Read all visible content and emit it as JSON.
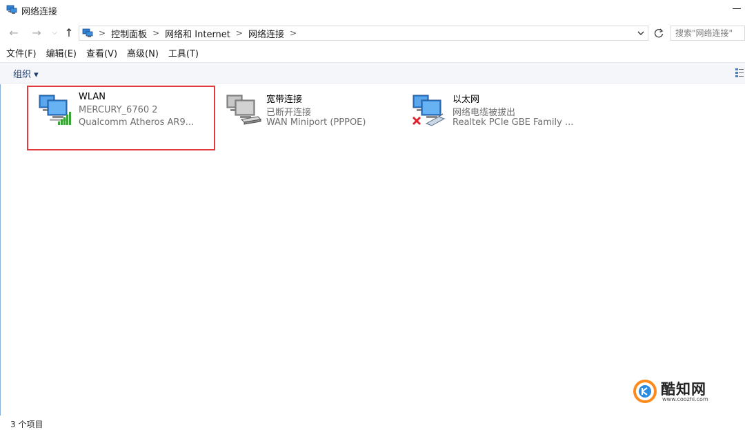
{
  "window": {
    "title": "网络连接"
  },
  "address": {
    "crumbs": [
      "控制面板",
      "网络和 Internet",
      "网络连接"
    ],
    "search_placeholder": "搜索\"网络连接\""
  },
  "menu": [
    "文件(F)",
    "编辑(E)",
    "查看(V)",
    "高级(N)",
    "工具(T)"
  ],
  "toolbar": {
    "organize_label": "组织 ▾"
  },
  "connections": [
    {
      "name": "WLAN",
      "status": "MERCURY_6760 2",
      "device": "Qualcomm Atheros AR9...",
      "badge": "wifi-signal-icon"
    },
    {
      "name": "宽带连接",
      "status": "已断开连接",
      "device": "WAN Miniport (PPPOE)",
      "badge": "modem-icon"
    },
    {
      "name": "以太网",
      "status": "网络电缆被拔出",
      "device": "Realtek PCIe GBE Family ...",
      "badge": "cable-unplugged-icon"
    }
  ],
  "status_bar": {
    "text": "3 个项目"
  },
  "watermark": {
    "name": "酷知网",
    "url": "www.coozhi.com"
  },
  "colors": {
    "highlight": "#e0393e",
    "link_blue": "#1e3e6e",
    "signal_green": "#3aa335"
  }
}
